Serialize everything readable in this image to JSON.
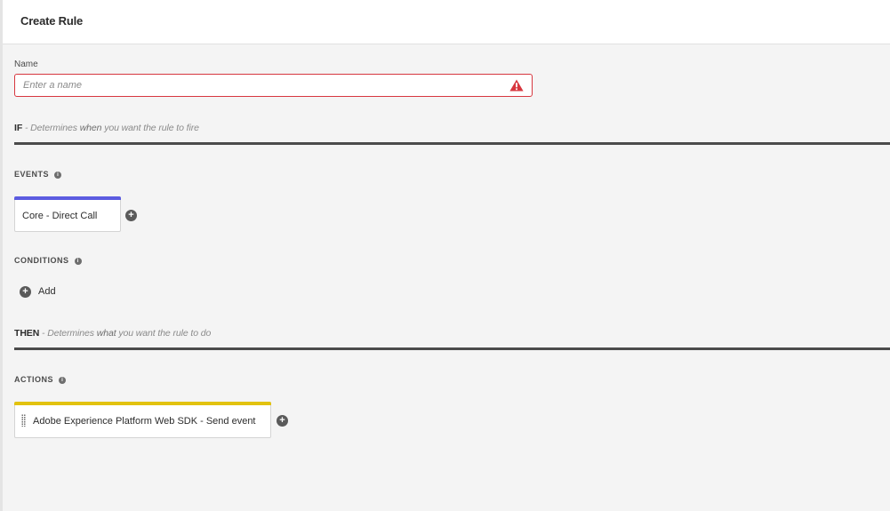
{
  "header": {
    "title": "Create Rule"
  },
  "name_field": {
    "label": "Name",
    "value": "",
    "placeholder": "Enter a name",
    "state": "error"
  },
  "if_section": {
    "keyword": "IF",
    "desc_pre": " - Determines ",
    "desc_em": "when",
    "desc_post": " you want the rule to fire"
  },
  "events": {
    "label": "EVENTS",
    "info": "i",
    "items": [
      {
        "label": "Core - Direct Call",
        "accent": "#5c5ce0"
      }
    ],
    "add_symbol": "+"
  },
  "conditions": {
    "label": "CONDITIONS",
    "info": "i",
    "add_symbol": "+",
    "add_label": "Add"
  },
  "then_section": {
    "keyword": "THEN",
    "desc_pre": " - Determines ",
    "desc_em": "what",
    "desc_post": " you want the rule to do"
  },
  "actions": {
    "label": "ACTIONS",
    "info": "i",
    "items": [
      {
        "label": "Adobe Experience Platform Web SDK - Send event",
        "accent": "#e2c20f"
      }
    ],
    "add_symbol": "+"
  },
  "colors": {
    "error": "#d7373f",
    "rule_line": "#4b4b4b",
    "background": "#f4f4f4"
  }
}
